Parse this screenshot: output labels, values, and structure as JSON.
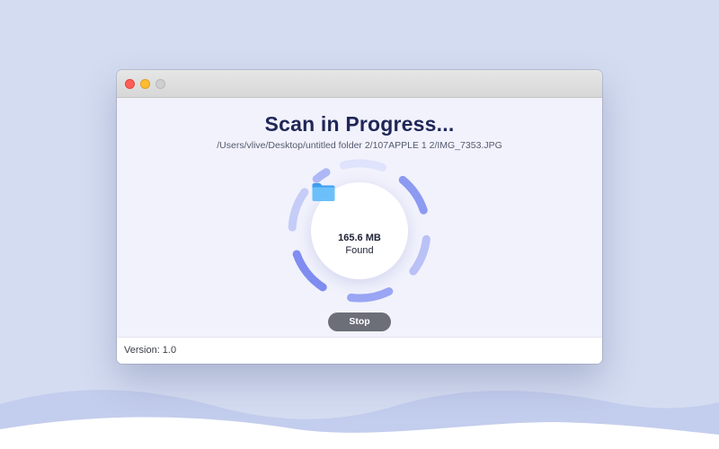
{
  "window": {
    "title_controls": [
      "close",
      "minimize",
      "maximize"
    ]
  },
  "scan": {
    "title": "Scan in Progress...",
    "path": "/Users/vlive/Desktop/untitled folder 2/107APPLE 1 2/IMG_7353.JPG",
    "found_size": "165.6 MB",
    "found_label": "Found",
    "stop_label": "Stop",
    "icon": "folder-icon"
  },
  "footer": {
    "version": "Version: 1.0"
  },
  "colors": {
    "background": "#d4dcf1",
    "title": "#1f2757",
    "ring_accent": "#7f8df0",
    "stop_button": "#6c6e78",
    "folder": "#5fb4f5"
  }
}
